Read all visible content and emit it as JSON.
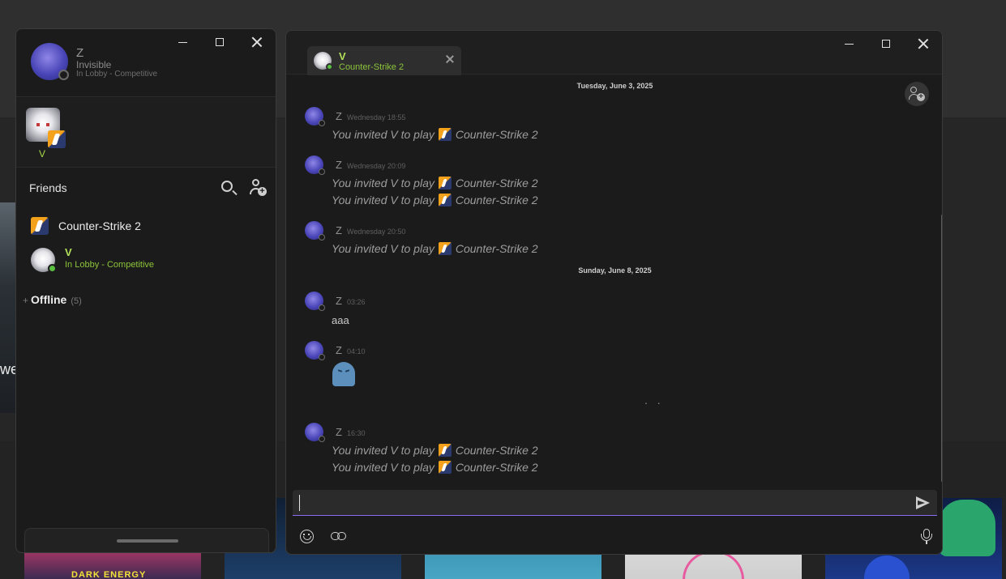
{
  "background": {
    "peek_text": "we",
    "thumb_label": "DARK ENERGY"
  },
  "friends_window": {
    "self": {
      "name": "Z",
      "status": "Invisible",
      "game": "In Lobby - Competitive"
    },
    "party": {
      "label": "V"
    },
    "friends_title": "Friends",
    "game_group": "Counter-Strike 2",
    "friend": {
      "name": "V",
      "status": "In Lobby - Competitive"
    },
    "offline": {
      "toggle": "+",
      "label": "Offline",
      "count": "(5)"
    }
  },
  "chat_window": {
    "tab": {
      "name": "V",
      "game": "Counter-Strike 2"
    },
    "dates": [
      "Tuesday, June 3, 2025",
      "Sunday, June 8, 2025"
    ],
    "invite_text": "You invited V to play",
    "game_name": "Counter-Strike 2",
    "groups": [
      {
        "sender": "Z",
        "time": "Wednesday 18:55"
      },
      {
        "sender": "Z",
        "time": "Wednesday 20:09"
      },
      {
        "sender": "Z",
        "time": "Wednesday 20:50"
      },
      {
        "sender": "Z",
        "time": "03:26",
        "text": "aaa"
      },
      {
        "sender": "Z",
        "time": "04:10"
      },
      {
        "sender": "Z",
        "time": "16:30"
      }
    ],
    "typing": ". .",
    "composer_placeholder": ""
  },
  "colors": {
    "accent_underline": "#8a6cf0",
    "online_green": "#59bf40",
    "friend_name": "#b3e05a"
  }
}
